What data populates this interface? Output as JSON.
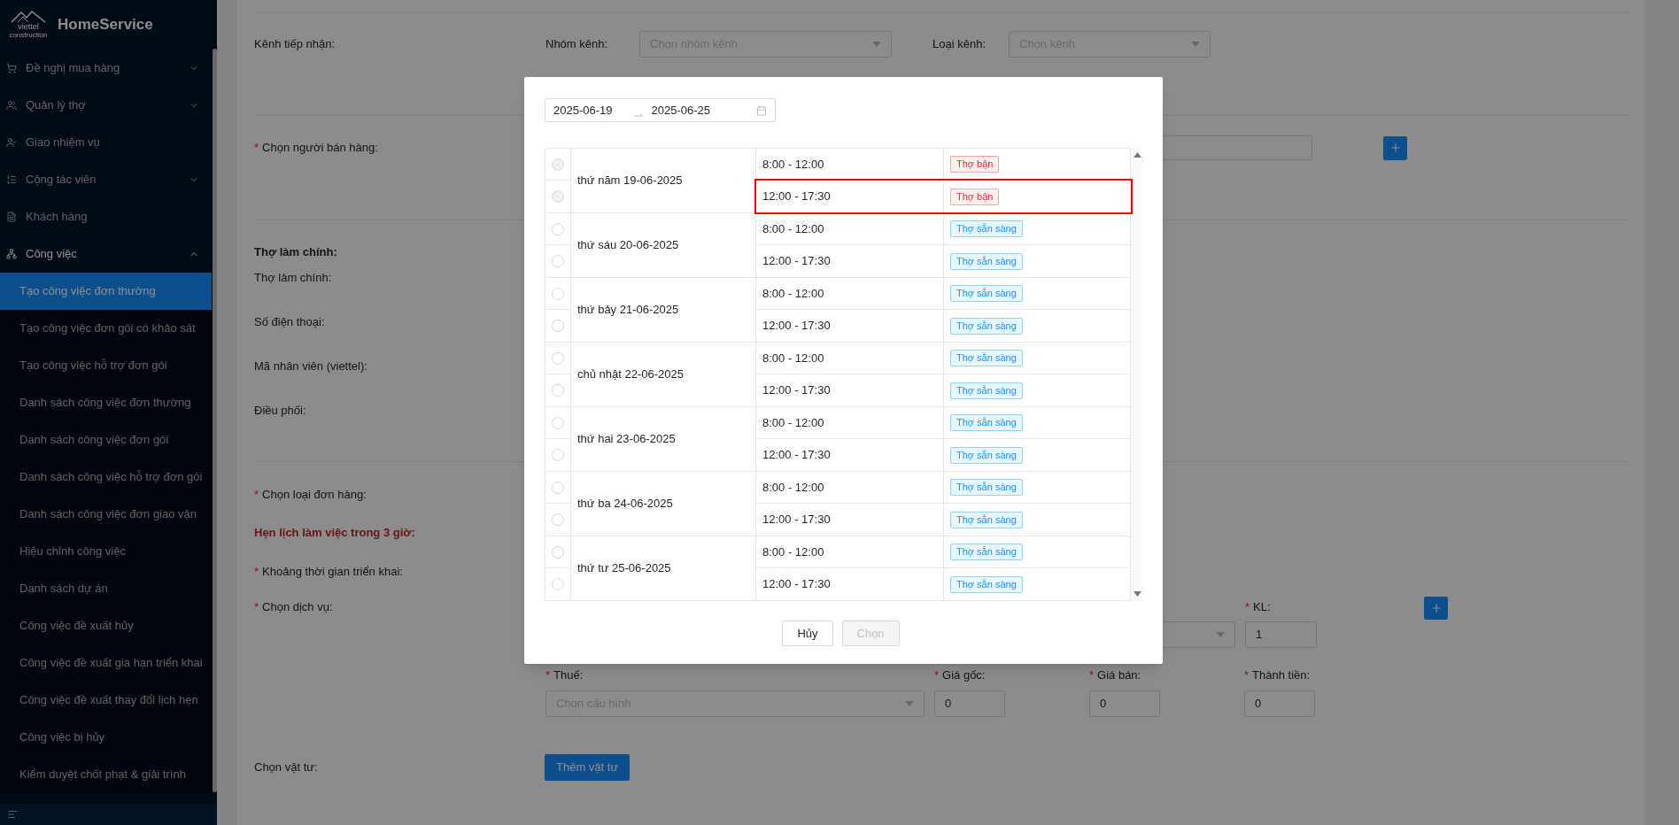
{
  "sidebar": {
    "logo": {
      "wordmark": "viettel",
      "tagline": "construction"
    },
    "brand": "HomeService",
    "items": [
      {
        "label": "Đề nghị mua hàng",
        "expanded": false,
        "selected": false
      },
      {
        "label": "Quản lý thợ",
        "expanded": false,
        "selected": false
      },
      {
        "label": "Giao nhiệm vụ",
        "selected": false
      },
      {
        "label": "Cộng tác viên",
        "expanded": false,
        "selected": false
      },
      {
        "label": "Khách hàng",
        "selected": false
      },
      {
        "label": "Công việc",
        "expanded": true,
        "selected": true,
        "children": [
          {
            "label": "Tạo công việc đơn thường",
            "selected": true
          },
          {
            "label": "Tạo công việc đơn gói có khảo sát",
            "selected": false
          },
          {
            "label": "Tạo công việc hỗ trợ đơn gói",
            "selected": false
          },
          {
            "label": "Danh sách công việc đơn thường",
            "selected": false
          },
          {
            "label": "Danh sách công việc đơn gói",
            "selected": false
          },
          {
            "label": "Danh sách công việc hỗ trợ đơn gói",
            "selected": false
          },
          {
            "label": "Danh sách công việc đơn giao vận",
            "selected": false
          },
          {
            "label": "Hiệu chỉnh công việc",
            "selected": false
          },
          {
            "label": "Danh sách dự án",
            "selected": false
          },
          {
            "label": "Công việc đề xuất hủy",
            "selected": false
          },
          {
            "label": "Công việc đề xuất gia hạn triển khai",
            "selected": false
          },
          {
            "label": "Công việc đề xuất thay đổi lịch hẹn",
            "selected": false
          },
          {
            "label": "Công việc bị hủy",
            "selected": false
          },
          {
            "label": "Kiểm duyệt chốt phạt & giải trình",
            "selected": false
          }
        ]
      }
    ]
  },
  "form": {
    "channel": {
      "label": "Kênh tiếp nhận:",
      "group_label": "Nhóm kênh:",
      "group_placeholder": "Chọn nhóm kênh",
      "type_label": "Loại kênh:",
      "type_placeholder": "Chọn kênh"
    },
    "seller": {
      "label": "Chọn người bán hàng:",
      "required": "*"
    },
    "worker": {
      "title": "Thợ làm chính:",
      "fields": [
        {
          "label": "Thợ làm chính:"
        },
        {
          "label": "Số điện thoại:"
        },
        {
          "label": "Mã nhân viên (viettel):"
        },
        {
          "label": "Điều phối:"
        }
      ]
    },
    "order_type": {
      "label": "Chọn loại đơn hàng:",
      "required": "*"
    },
    "schedule_note": "Hẹn lịch làm việc trong 3 giờ:",
    "deploy_period": {
      "label": "Khoảng thời gian triển khai:",
      "required": "*"
    },
    "service": {
      "label": "Chọn dịch vụ:",
      "required": "*",
      "kl_label": "KL:",
      "kl_required": "*",
      "kl_value": "1"
    },
    "pricing": [
      {
        "kind": "select",
        "label": "Thuế:",
        "required": "*",
        "placeholder": "Chọn cấu hình"
      },
      {
        "kind": "input",
        "label": "Giá gốc:",
        "required": "*",
        "value": "0"
      },
      {
        "kind": "input",
        "label": "Giá bán:",
        "required": "*",
        "value": "0"
      },
      {
        "kind": "input",
        "label": "Thành tiền:",
        "required": "*",
        "value": "0"
      }
    ],
    "materials": {
      "label": "Chọn vật tư:",
      "button": "Thêm vật tư"
    }
  },
  "modal": {
    "date_range": {
      "start": "2025-06-19",
      "end": "2025-06-25"
    },
    "days": [
      {
        "date": "thứ năm 19-06-2025",
        "slots": [
          {
            "time": "8:00 - 12:00",
            "status": "Thợ bận",
            "kind": "busy",
            "disabled": true,
            "selected": false,
            "highlighted": false
          },
          {
            "time": "12:00 - 17:30",
            "status": "Thợ bận",
            "kind": "busy",
            "disabled": true,
            "selected": false,
            "highlighted": true
          }
        ]
      },
      {
        "date": "thứ sáu 20-06-2025",
        "slots": [
          {
            "time": "8:00 - 12:00",
            "status": "Thợ sẵn sàng",
            "kind": "available",
            "disabled": false,
            "selected": false,
            "highlighted": false
          },
          {
            "time": "12:00 - 17:30",
            "status": "Thợ sẵn sàng",
            "kind": "available",
            "disabled": false,
            "selected": false,
            "highlighted": false
          }
        ]
      },
      {
        "date": "thứ bảy 21-06-2025",
        "slots": [
          {
            "time": "8:00 - 12:00",
            "status": "Thợ sẵn sàng",
            "kind": "available",
            "disabled": false,
            "selected": false,
            "highlighted": false
          },
          {
            "time": "12:00 - 17:30",
            "status": "Thợ sẵn sàng",
            "kind": "available",
            "disabled": false,
            "selected": false,
            "highlighted": false
          }
        ]
      },
      {
        "date": "chủ nhật 22-06-2025",
        "slots": [
          {
            "time": "8:00 - 12:00",
            "status": "Thợ sẵn sàng",
            "kind": "available",
            "disabled": false,
            "selected": false,
            "highlighted": false
          },
          {
            "time": "12:00 - 17:30",
            "status": "Thợ sẵn sàng",
            "kind": "available",
            "disabled": false,
            "selected": false,
            "highlighted": false
          }
        ]
      },
      {
        "date": "thứ hai 23-06-2025",
        "slots": [
          {
            "time": "8:00 - 12:00",
            "status": "Thợ sẵn sàng",
            "kind": "available",
            "disabled": false,
            "selected": false,
            "highlighted": false
          },
          {
            "time": "12:00 - 17:30",
            "status": "Thợ sẵn sàng",
            "kind": "available",
            "disabled": false,
            "selected": false,
            "highlighted": false
          }
        ]
      },
      {
        "date": "thứ ba 24-06-2025",
        "slots": [
          {
            "time": "8:00 - 12:00",
            "status": "Thợ sẵn sàng",
            "kind": "available",
            "disabled": false,
            "selected": false,
            "highlighted": false
          },
          {
            "time": "12:00 - 17:30",
            "status": "Thợ sẵn sàng",
            "kind": "available",
            "disabled": false,
            "selected": false,
            "highlighted": false
          }
        ]
      },
      {
        "date": "thứ tư 25-06-2025",
        "slots": [
          {
            "time": "8:00 - 12:00",
            "status": "Thợ sẵn sàng",
            "kind": "available",
            "disabled": false,
            "selected": false,
            "highlighted": false
          },
          {
            "time": "12:00 - 17:30",
            "status": "Thợ sẵn sàng",
            "kind": "available",
            "disabled": false,
            "selected": false,
            "highlighted": false
          }
        ]
      }
    ],
    "buttons": [
      {
        "label": "Hủy",
        "disabled": false
      },
      {
        "label": "Chọn",
        "disabled": true
      }
    ]
  }
}
